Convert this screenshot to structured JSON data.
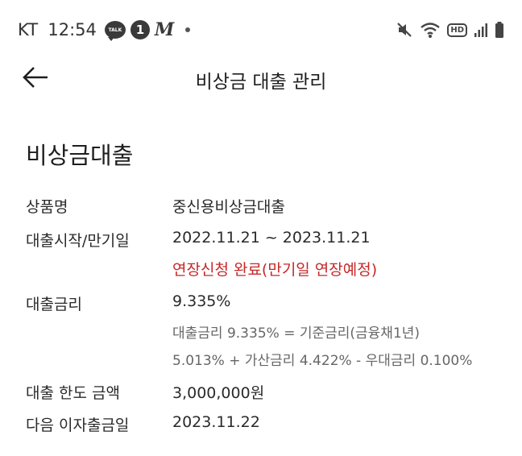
{
  "status_bar": {
    "carrier": "KT",
    "time": "12:54",
    "talk_text": "TALK",
    "badge_count": "1",
    "m_glyph": "M",
    "icons": [
      "talk-icon",
      "badge-icon",
      "m-icon",
      "dot-icon",
      "mute-icon",
      "wifi-icon",
      "hd-icon",
      "signal-icon",
      "battery-icon"
    ],
    "hd_text": "HD"
  },
  "app_bar": {
    "title": "비상금 대출 관리",
    "back_icon": "arrow-left-icon"
  },
  "section": {
    "title": "비상금대출"
  },
  "details": {
    "product_label": "상품명",
    "product_value": "중신용비상금대출",
    "period_label": "대출시작/만기일",
    "period_value": "2022.11.21 ~ 2023.11.21",
    "period_status": "연장신청 완료(만기일 연장예정)",
    "rate_label": "대출금리",
    "rate_value": "9.335%",
    "rate_note_1": "대출금리 9.335% = 기준금리(금융채1년)",
    "rate_note_2": "5.013% + 가산금리 4.422% - 우대금리 0.100%",
    "limit_label": "대출 한도 금액",
    "limit_value": "3,000,000원",
    "next_interest_label": "다음 이자출금일",
    "next_interest_value": "2023.11.22"
  },
  "colors": {
    "alert": "#c62828",
    "text": "#1f1f1f",
    "note": "#666666"
  }
}
